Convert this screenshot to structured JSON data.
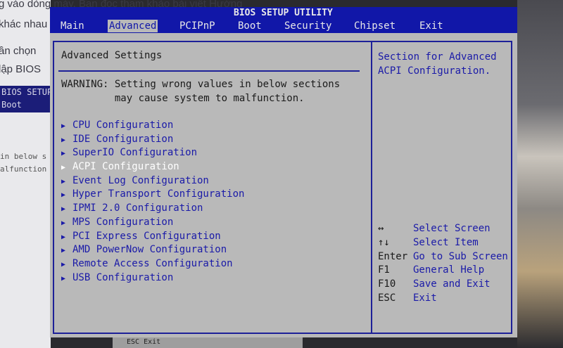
{
  "background": {
    "lines": [
      "g vào dòng máy. Bạn đọc tham khảo bài viết Hướng",
      "khác nhau",
      "ần chọn",
      "lập BIOS"
    ],
    "bios_thumb": [
      "BIOS SETUP",
      "Boot"
    ],
    "mono_lines": [
      "in below s",
      "alfunction"
    ],
    "bottom_text": "ESC   Exit"
  },
  "bios": {
    "title": "BIOS SETUP UTILITY",
    "menu": [
      "Main",
      "Advanced",
      "PCIPnP",
      "Boot",
      "Security",
      "Chipset",
      "Exit"
    ],
    "active_menu": "Advanced",
    "heading": "Advanced Settings",
    "warning_line1": "WARNING: Setting wrong values in below sections",
    "warning_line2": "         may cause system to malfunction.",
    "items": [
      "CPU Configuration",
      "IDE Configuration",
      "SuperIO Configuration",
      "ACPI Configuration",
      "Event Log Configuration",
      "Hyper Transport Configuration",
      "IPMI 2.0 Configuration",
      "MPS Configuration",
      "PCI Express Configuration",
      "AMD PowerNow Configuration",
      "Remote Access Configuration",
      "USB Configuration"
    ],
    "selected_item": "ACPI Configuration",
    "help_line1": "Section for Advanced",
    "help_line2": "ACPI Configuration.",
    "keys": [
      {
        "key": "↔",
        "desc": "Select Screen"
      },
      {
        "key": "↑↓",
        "desc": "Select Item"
      },
      {
        "key": "Enter",
        "desc": "Go to Sub Screen"
      },
      {
        "key": "F1",
        "desc": "General Help"
      },
      {
        "key": "F10",
        "desc": "Save and Exit"
      },
      {
        "key": "ESC",
        "desc": "Exit"
      }
    ],
    "colors": {
      "bar_blue": "#1117a8",
      "panel_gray": "#b9b9b9",
      "item_blue": "#1a1aa8",
      "selected": "#ffffff"
    }
  }
}
